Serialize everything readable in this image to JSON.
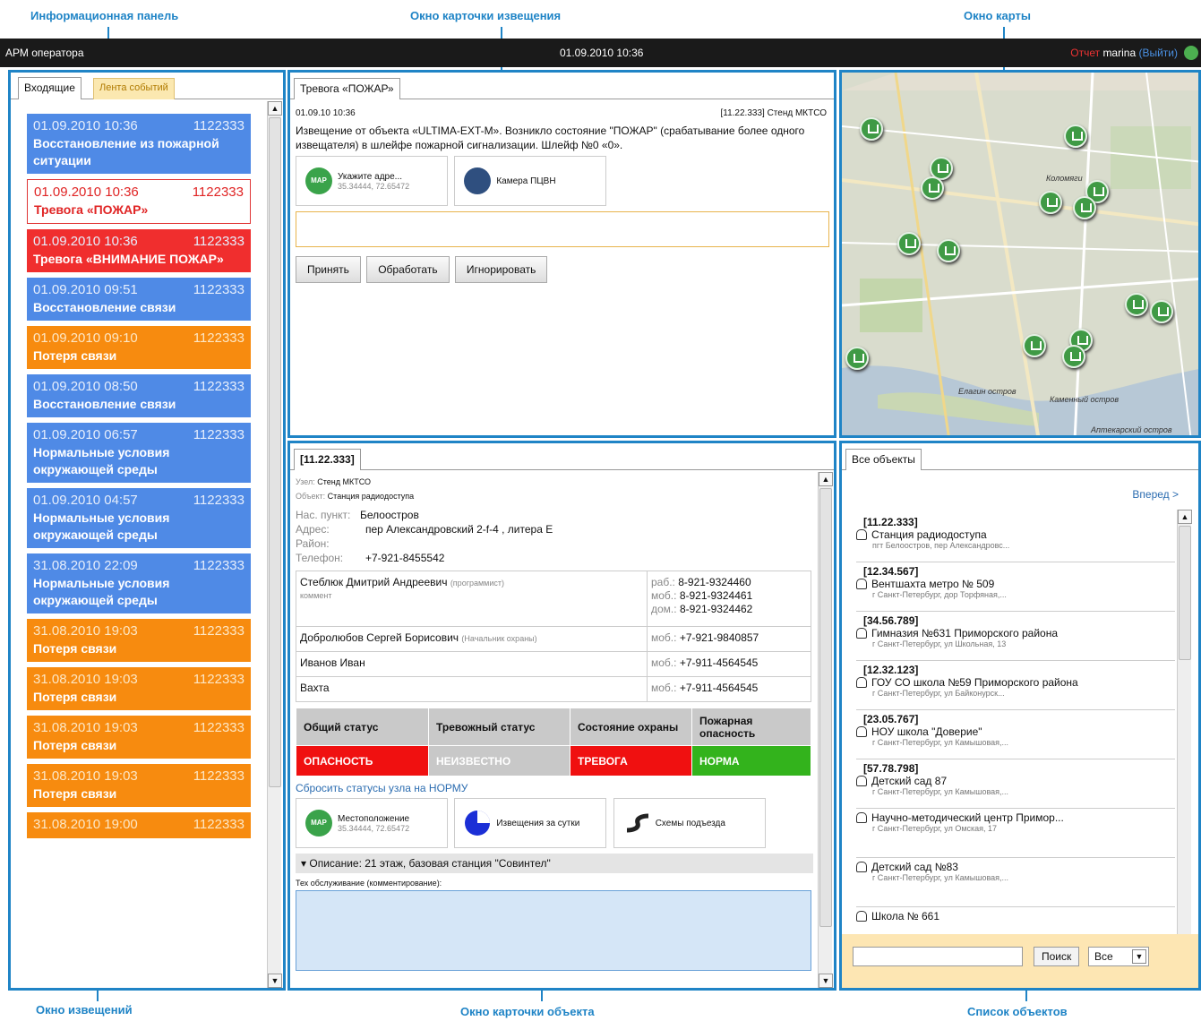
{
  "callouts": {
    "info_panel": "Информационная панель",
    "alert_window": "Окно карточки извещения",
    "map_window": "Окно карты",
    "notif_window": "Окно извещений",
    "object_window": "Окно карточки объекта",
    "object_list": "Список объектов"
  },
  "topbar": {
    "app_title": "АРМ оператора",
    "datetime": "01.09.2010 10:36",
    "report": "Отчет",
    "user": "marina",
    "logout": "(Выйти)"
  },
  "notifications": {
    "tabs": [
      "Входящие",
      "Лента событий"
    ],
    "items": [
      {
        "date": "01.09.2010 10:36",
        "id": "1122333",
        "text": "Восстановление из пожарной ситуации",
        "color": "blue"
      },
      {
        "date": "01.09.2010 10:36",
        "id": "1122333",
        "text": "Тревога «ПОЖАР»",
        "color": "white"
      },
      {
        "date": "01.09.2010 10:36",
        "id": "1122333",
        "text": "Тревога «ВНИМАНИЕ ПОЖАР»",
        "color": "red"
      },
      {
        "date": "01.09.2010 09:51",
        "id": "1122333",
        "text": "Восстановление связи",
        "color": "blue"
      },
      {
        "date": "01.09.2010 09:10",
        "id": "1122333",
        "text": "Потеря связи",
        "color": "orange"
      },
      {
        "date": "01.09.2010 08:50",
        "id": "1122333",
        "text": "Восстановление связи",
        "color": "blue"
      },
      {
        "date": "01.09.2010 06:57",
        "id": "1122333",
        "text": "Нормальные условия окружающей среды",
        "color": "blue"
      },
      {
        "date": "01.09.2010 04:57",
        "id": "1122333",
        "text": "Нормальные условия окружающей среды",
        "color": "blue"
      },
      {
        "date": "31.08.2010 22:09",
        "id": "1122333",
        "text": "Нормальные условия окружающей среды",
        "color": "blue"
      },
      {
        "date": "31.08.2010 19:03",
        "id": "1122333",
        "text": "Потеря связи",
        "color": "orange"
      },
      {
        "date": "31.08.2010 19:03",
        "id": "1122333",
        "text": "Потеря связи",
        "color": "orange"
      },
      {
        "date": "31.08.2010 19:03",
        "id": "1122333",
        "text": "Потеря связи",
        "color": "orange"
      },
      {
        "date": "31.08.2010 19:03",
        "id": "1122333",
        "text": "Потеря связи",
        "color": "orange"
      },
      {
        "date": "31.08.2010 19:00",
        "id": "1122333",
        "text": "",
        "color": "orange"
      }
    ]
  },
  "alert": {
    "tab": "Тревога «ПОЖАР»",
    "date": "01.09.10 10:36",
    "source": "[11.22.333] Стенд МКТСО",
    "text": "Извещение от объекта «ULTIMA-EXT-M». Возникло состояние \"ПОЖАР\" (срабатывание более одного извещателя) в шлейфе пожарной сигнализации. Шлейф №0 «0».",
    "map_badge": "MAP",
    "map_title": "Укажите адре...",
    "map_coords": "35.34444, 72.65472",
    "camera": "Камера ПЦВН",
    "buttons": [
      "Принять",
      "Обработать",
      "Игнорировать"
    ]
  },
  "map": {
    "labels": [
      "Коломяги",
      "Елагин остров",
      "Каменный остров",
      "Аптекарский остров"
    ]
  },
  "object": {
    "tab": "[11.22.333]",
    "node_label": "Узел:",
    "node": "Стенд МКТСО",
    "obj_label": "Объект:",
    "obj": "Станция радиодоступа",
    "city_label": "Нас. пункт:",
    "city": "Белоостров",
    "addr_label": "Адрес:",
    "addr": "пер Александровский 2-f-4 , литера Е",
    "district_label": "Район:",
    "phone_label": "Телефон:",
    "phone": "+7-921-8455542",
    "contacts": [
      {
        "name": "Стеблюк Дмитрий Андреевич",
        "role": "(программист)",
        "note": "коммент",
        "phones": [
          [
            "раб.:",
            "8-921-9324460"
          ],
          [
            "моб.:",
            "8-921-9324461"
          ],
          [
            "дом.:",
            "8-921-9324462"
          ]
        ]
      },
      {
        "name": "Добролюбов Сергей Борисович",
        "role": "(Начальник охраны)",
        "note": "",
        "phones": [
          [
            "моб.:",
            "+7-921-9840857"
          ]
        ]
      },
      {
        "name": "Иванов Иван",
        "role": "",
        "note": "",
        "phones": [
          [
            "моб.:",
            "+7-911-4564545"
          ]
        ]
      },
      {
        "name": "Вахта",
        "role": "",
        "note": "",
        "phones": [
          [
            "моб.:",
            "+7-911-4564545"
          ]
        ]
      }
    ],
    "status_heads": [
      "Общий статус",
      "Тревожный статус",
      "Состояние охраны",
      "Пожарная опасность"
    ],
    "status_vals": [
      "ОПАСНОСТЬ",
      "НЕИЗВЕСТНО",
      "ТРЕВОГА",
      "НОРМА"
    ],
    "status_colors": [
      "#f01010",
      "#c8c8c8",
      "#f01010",
      "#33b31c"
    ],
    "reset": "Сбросить статусы узла на НОРМУ",
    "loc_badge": "MAP",
    "loc_title": "Местоположение",
    "loc_coords": "35.34444, 72.65472",
    "daily": "Извещения за сутки",
    "schemes": "Схемы подъезда",
    "desc": "Описание: 21 этаж, базовая станция \"Совинтел\"",
    "maint": "Тех обслуживание (комментирование):"
  },
  "objlist": {
    "tab": "Все объекты",
    "forward": "Вперед >",
    "items": [
      {
        "id": "[11.22.333]",
        "name": "Станция радиодоступа",
        "addr": "пгт Белоостров, пер Александровс..."
      },
      {
        "id": "[12.34.567]",
        "name": "Вентшахта метро № 509",
        "addr": "г Санкт-Петербург, дор Торфяная,..."
      },
      {
        "id": "[34.56.789]",
        "name": "Гимназия №631 Приморского района",
        "addr": "г Санкт-Петербург, ул Школьная, 13"
      },
      {
        "id": "[12.32.123]",
        "name": "ГОУ СО школа №59 Приморского района",
        "addr": "г Санкт-Петербург, ул Байконурск..."
      },
      {
        "id": "[23.05.767]",
        "name": "НОУ школа \"Доверие\"",
        "addr": "г Санкт-Петербург, ул Камышовая,..."
      },
      {
        "id": "[57.78.798]",
        "name": "Детский сад 87",
        "addr": "г Санкт-Петербург, ул Камышовая,..."
      },
      {
        "id": "",
        "name": "Научно-методический центр Примор...",
        "addr": "г Санкт-Петербург, ул Омская, 17"
      },
      {
        "id": "",
        "name": "Детский сад №83",
        "addr": "г Санкт-Петербург, ул Камышовая,..."
      },
      {
        "id": "",
        "name": "Школа № 661",
        "addr": ""
      }
    ],
    "search_btn": "Поиск",
    "select_value": "Все"
  }
}
